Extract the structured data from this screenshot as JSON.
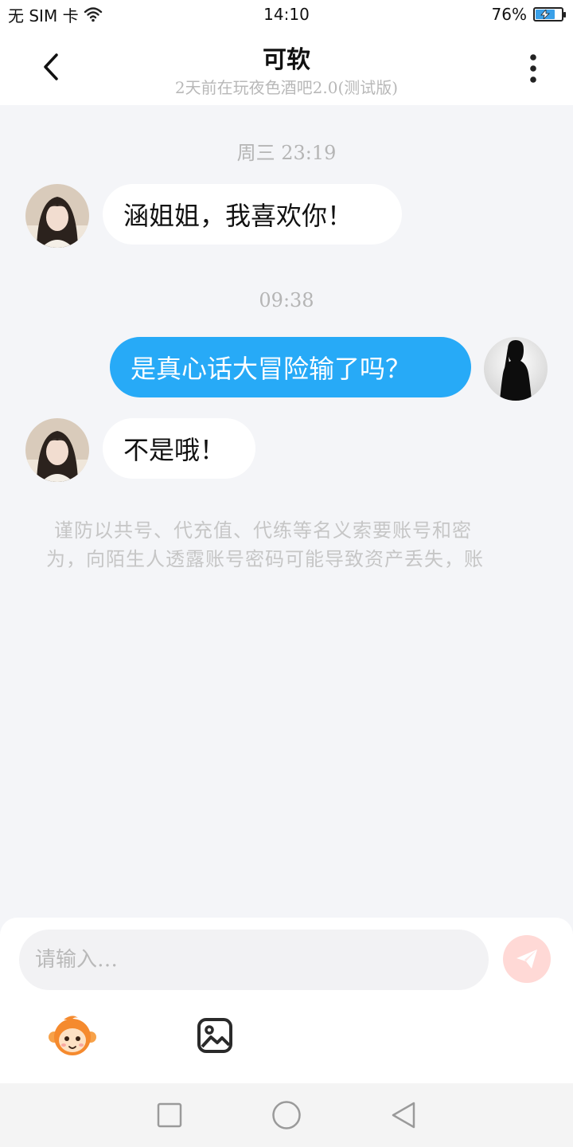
{
  "status_bar": {
    "carrier": "无 SIM 卡",
    "time": "14:10",
    "battery_percent": "76%",
    "battery_level": 0.76
  },
  "header": {
    "title": "可软",
    "subtitle": "2天前在玩夜色酒吧2.0(测试版)"
  },
  "messages": [
    {
      "type": "timestamp",
      "text": "周三 23:19"
    },
    {
      "type": "incoming",
      "text": "涵姐姐，我喜欢你！"
    },
    {
      "type": "timestamp",
      "text": "09:38"
    },
    {
      "type": "outgoing",
      "text": "是真心话大冒险输了吗？"
    },
    {
      "type": "incoming",
      "text": "不是哦！"
    }
  ],
  "notice": {
    "line1": "谨防以共号、代充值、代练等名义索要账号和密",
    "line2": "为，向陌生人透露账号密码可能导致资产丢失，账"
  },
  "composer": {
    "placeholder": "请输入…"
  },
  "colors": {
    "outgoing_bubble": "#27aaf7",
    "send_button": "#ffd9d6",
    "background": "#f4f5f8"
  },
  "icons": {
    "back": "chevron-left-icon",
    "more": "more-vertical-icon",
    "send": "paper-plane-icon",
    "emoji": "monkey-emoji-icon",
    "image": "image-icon",
    "nav_recent": "square-icon",
    "nav_home": "circle-icon",
    "nav_back": "triangle-back-icon"
  }
}
